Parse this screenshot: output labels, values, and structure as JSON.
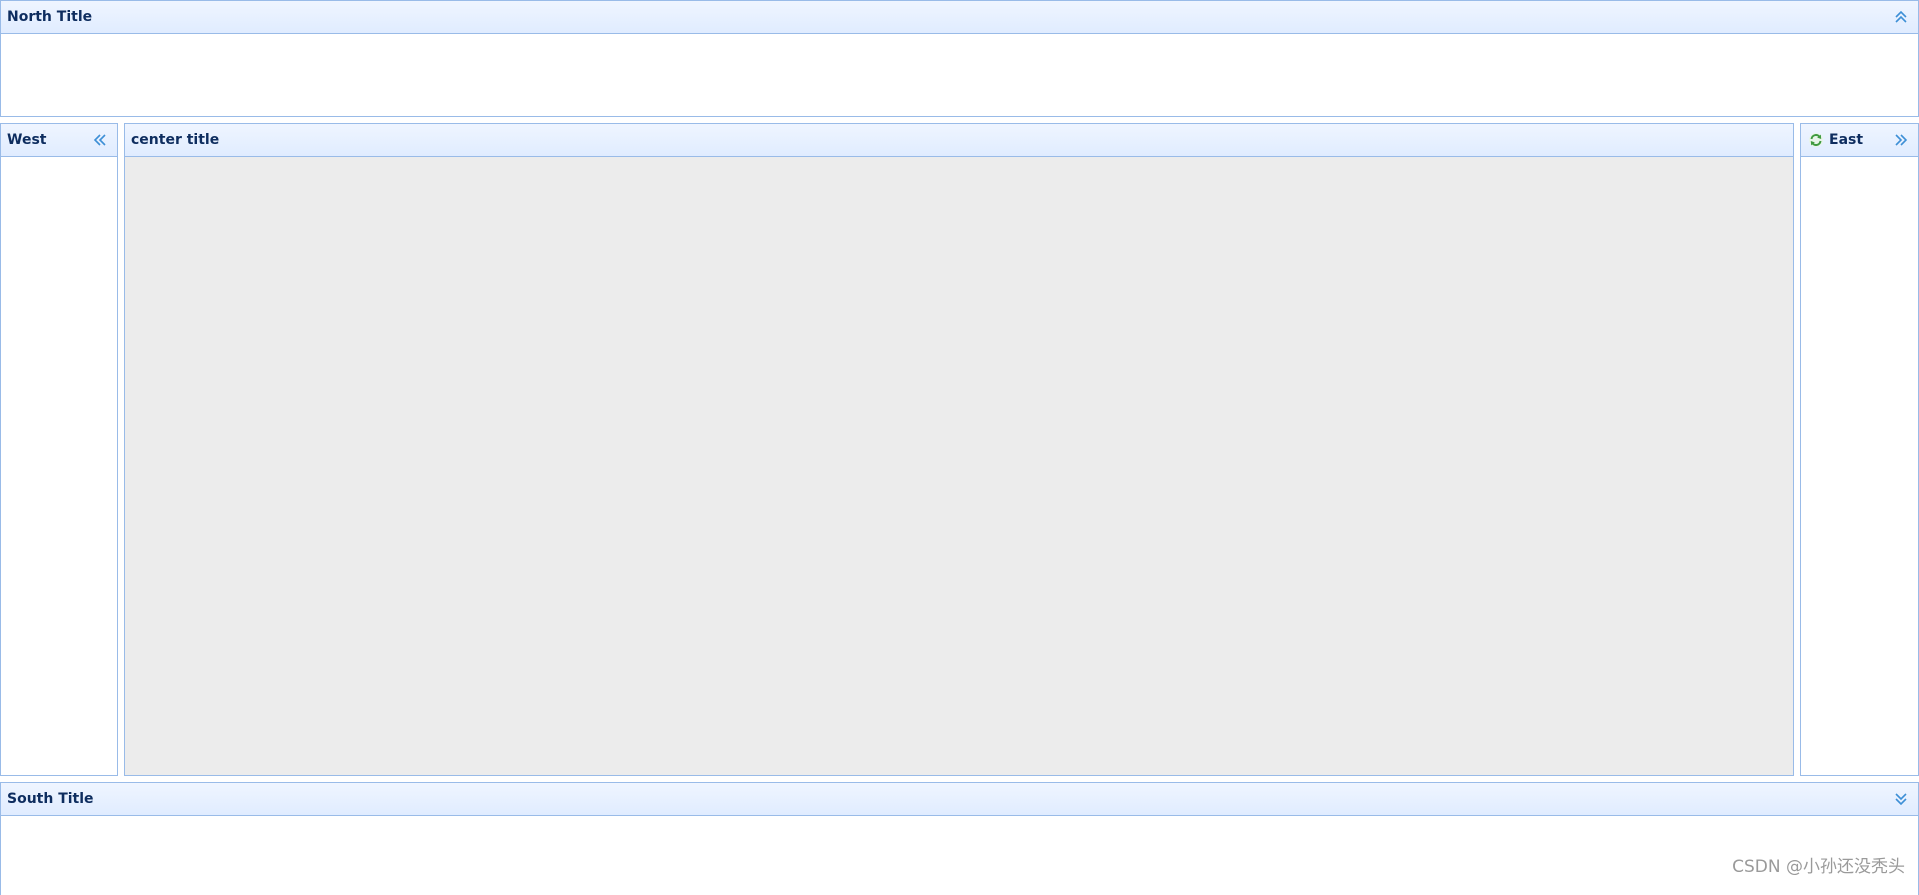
{
  "north": {
    "title": "North Title",
    "tool_icon": "double-chevron-up-icon"
  },
  "west": {
    "title": "West",
    "tool_icon": "double-chevron-left-icon"
  },
  "center": {
    "title": "center title"
  },
  "east": {
    "title": "East",
    "title_icon": "refresh-icon",
    "tool_icon": "double-chevron-right-icon"
  },
  "south": {
    "title": "South Title",
    "tool_icon": "double-chevron-down-icon"
  },
  "watermark": {
    "text": "CSDN @小孙还没秃头"
  },
  "colors": {
    "border": "#99bbe8",
    "header_top": "#eff5ff",
    "header_bottom": "#e0ecff",
    "title_text": "#0e2d5f",
    "center_body": "#ececec",
    "tool_icon": "#3d8fd6",
    "refresh_icon": "#4caf50"
  }
}
